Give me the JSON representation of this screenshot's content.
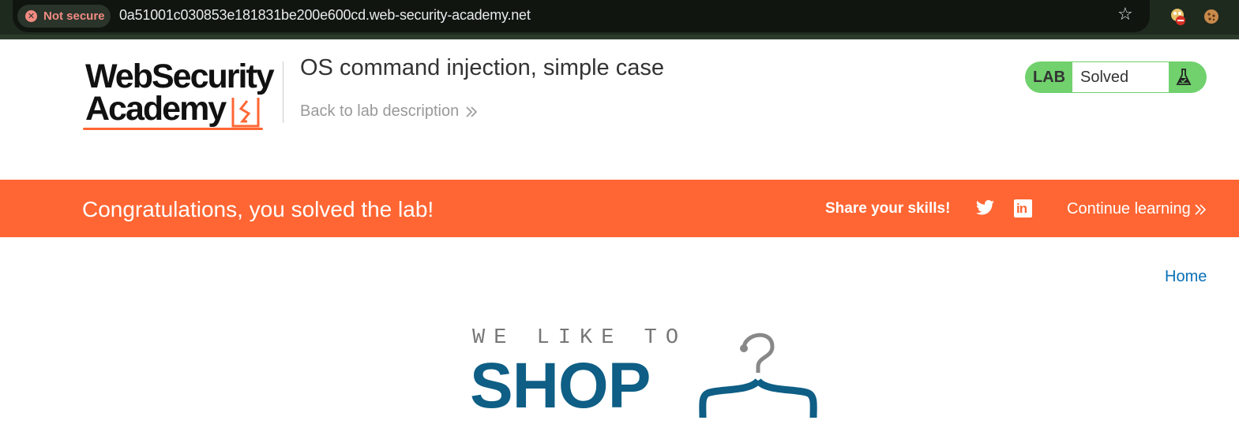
{
  "browser": {
    "security_chip": "Not secure",
    "url": "0a51001c030853e181831be200e600cd.web-security-academy.net",
    "icons": [
      "not-secure-icon",
      "bookmark-star-icon",
      "extension-icon",
      "cookie-extension-icon"
    ]
  },
  "header": {
    "logo_line1": "WebSecurity",
    "logo_line2": "Academy",
    "lab_title": "OS command injection, simple case",
    "back_link": "Back to lab description",
    "lab_badge": "LAB",
    "lab_status": "Solved"
  },
  "banner": {
    "message": "Congratulations, you solved the lab!",
    "share_label": "Share your skills!",
    "continue_label": "Continue learning",
    "color": "#ff6633"
  },
  "nav": {
    "home": "Home"
  },
  "shop_logo": {
    "tagline": "WE LIKE TO",
    "word": "SHOP"
  },
  "colors": {
    "accent_orange": "#ff6633",
    "lab_green": "#70d16d",
    "link_blue": "#0a70b6",
    "shop_blue": "#0e5e85"
  }
}
